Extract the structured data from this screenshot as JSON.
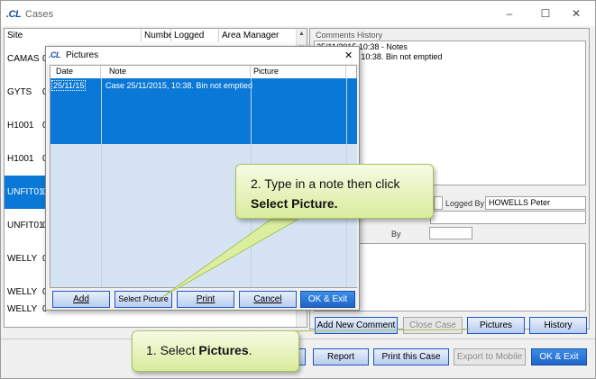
{
  "window": {
    "title": "Cases",
    "logo": ".CL"
  },
  "grid": {
    "columns": [
      "Site",
      "Number",
      "Logged",
      "Area Manager"
    ],
    "rows": [
      {
        "site": "CAMAS",
        "num": "0"
      },
      {
        "site": "GYTS",
        "num": "0"
      },
      {
        "site": "H1001",
        "num": "0"
      },
      {
        "site": "H1001",
        "num": "0"
      },
      {
        "site": "UNFIT01",
        "num": "0",
        "selected": true
      },
      {
        "site": "UNFIT01",
        "num": "0"
      },
      {
        "site": "WELLY",
        "num": "0"
      },
      {
        "site": "WELLY",
        "num": "0"
      },
      {
        "site": "WELLY",
        "num": "0"
      }
    ]
  },
  "comments": {
    "label": "Comments History",
    "lines": [
      "25/11/2015 10:38 - Notes",
      "25/11/2015, 10:38. Bin not emptied"
    ]
  },
  "fields": {
    "logged_by_label": "Logged By",
    "logged_by_value": "HOWELLS Peter",
    "partial_label_1": "ed",
    "by_label": "By"
  },
  "right_buttons": {
    "add_comment": "Add New Comment",
    "close_case": "Close Case",
    "pictures": "Pictures",
    "history": "History"
  },
  "bottom_buttons": {
    "report": "Report",
    "print_case": "Print this Case",
    "export_mobile": "Export to Mobile",
    "ok_exit": "OK & Exit"
  },
  "dialog": {
    "title": "Pictures",
    "columns": [
      "Date",
      "Note",
      "Picture"
    ],
    "row": {
      "date": "25/11/15",
      "note": "Case 25/11/2015, 10:38. Bin not emptied"
    },
    "buttons": {
      "add": "Add",
      "select_picture": "Select Picture",
      "print": "Print",
      "cancel": "Cancel",
      "ok_exit": "OK & Exit"
    }
  },
  "callouts": {
    "step2_text": "2. Type in a note then click ",
    "step2_bold": "Select Picture.",
    "step1_text": "1. Select ",
    "step1_bold": "Pictures",
    "step1_end": "."
  },
  "colors": {
    "selection": "#0a78d7",
    "callout_fill": "#d9ec9c",
    "button_border": "#1f57c4"
  }
}
